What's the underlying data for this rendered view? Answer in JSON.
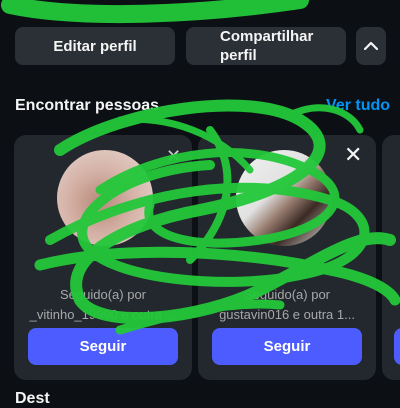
{
  "profile_actions": {
    "edit_label": "Editar perfil",
    "share_label_1": "Compartilhar",
    "share_label_2": "perfil",
    "expand_icon": "chevron-up-icon"
  },
  "discover": {
    "title": "Encontrar pessoas",
    "see_all": "Ver tudo",
    "cards": [
      {
        "name": "",
        "sub_line_1": "Seguido(a) por",
        "sub_line_2": "_vitinho_19990 e outra ...",
        "follow_label": "Seguir",
        "close_icon": "close-icon"
      },
      {
        "name": "",
        "sub_line_1": "Seguido(a) por",
        "sub_line_2": "gustavin016 e outra 1...",
        "follow_label": "Seguir",
        "close_icon": "close-icon"
      }
    ]
  },
  "bottom": {
    "label": "Dest"
  },
  "colors": {
    "background": "#0c1014",
    "button": "#2b3036",
    "card": "#23282e",
    "accent": "#0095f6",
    "follow": "#4d5cff",
    "scribble": "#23c83a"
  }
}
